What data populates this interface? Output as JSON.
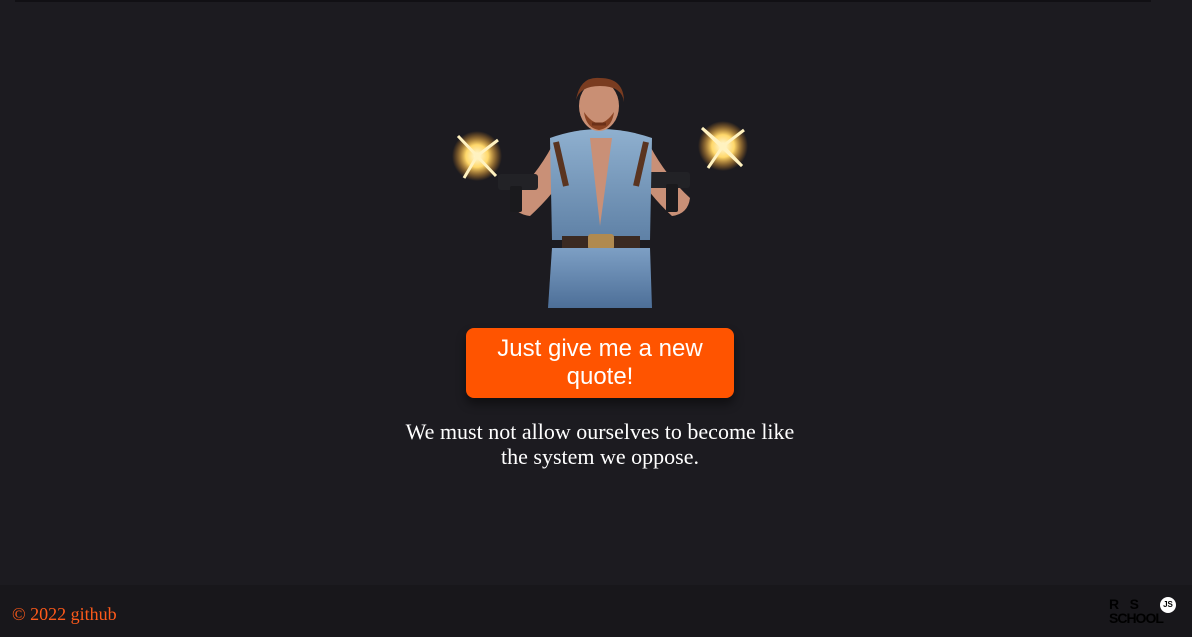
{
  "main": {
    "hero_image": {
      "alt": "",
      "description_icon": "chuck-norris-image"
    },
    "button_label": "Just give me a new quote!",
    "quote": "We must not allow ourselves to become like the system we oppose."
  },
  "footer": {
    "copyright": "© 2022 github",
    "logo": {
      "line1": "R    S",
      "line2": "SCHOOL",
      "badge": "JS"
    }
  },
  "colors": {
    "background": "#1c1b20",
    "footer_background": "#18171b",
    "accent": "#ff5400",
    "link": "#ff5a1a",
    "text": "#ffffff"
  }
}
